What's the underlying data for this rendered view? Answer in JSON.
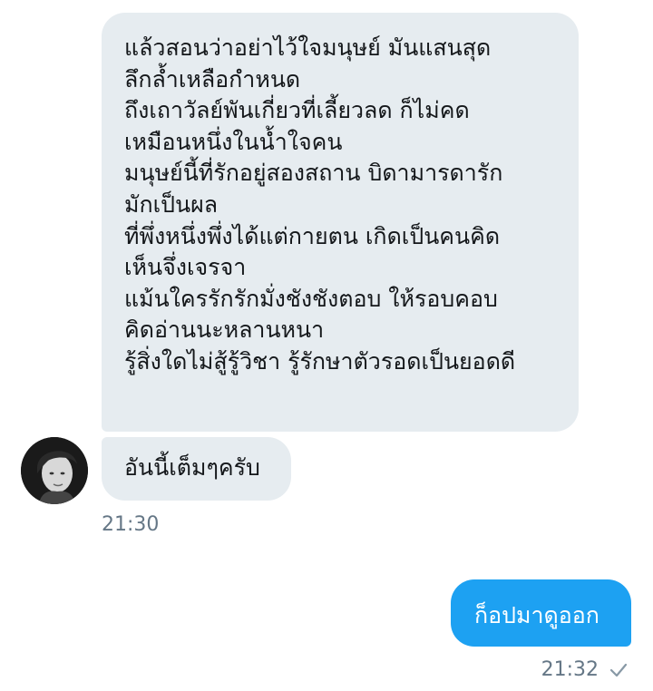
{
  "messages": {
    "incoming_poem": {
      "lines": [
        "แล้วสอนว่าอย่าไว้ใจมนุษย์ มันแสนสุด",
        "ลึกล้ำเหลือกำหนด",
        "ถึงเถาวัลย์พันเกี่ยวที่เลี้ยวลด ก็ไม่คด",
        "เหมือนหนึ่งในน้ำใจคน",
        "มนุษย์นี้ที่รักอยู่สองสถาน บิดามารดารัก",
        "มักเป็นผล",
        "ที่พึ่งหนึ่งพึ่งได้แต่กายตน เกิดเป็นคนคิด",
        "เห็นจึ่งเจรจา",
        "แม้นใครรักรักมั่งชังชังตอบ ให้รอบคอบ",
        "คิดอ่านนะหลานหนา",
        "รู้สิ่งใดไม่สู้รู้วิชา รู้รักษาตัวรอดเป็นยอดดี"
      ]
    },
    "incoming_reply": {
      "text": "อันนี้เต็มๆครับ",
      "time": "21:30"
    },
    "outgoing": {
      "text": "ก็อปมาดูออก",
      "time": "21:32",
      "status_icon": "check-icon"
    }
  },
  "colors": {
    "incoming_bubble": "#e6ecf0",
    "outgoing_bubble": "#1da1f2",
    "timestamp": "#657786",
    "text": "#14171a"
  }
}
